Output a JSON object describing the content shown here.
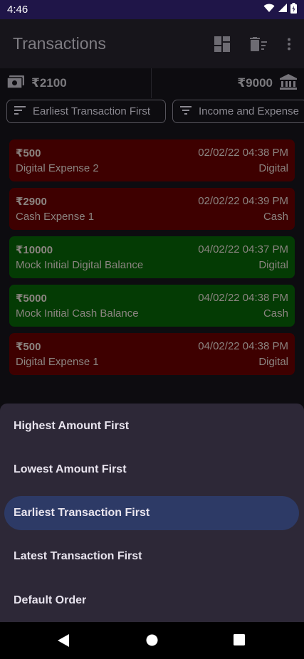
{
  "status_bar": {
    "time": "4:46"
  },
  "app_bar": {
    "title": "Transactions"
  },
  "balances": {
    "cash": "₹2100",
    "digital": "₹9000"
  },
  "filters": {
    "sort": "Earliest Transaction First",
    "type": "Income and Expense"
  },
  "transactions": [
    {
      "amount": "₹500",
      "datetime": "02/02/22 04:38 PM",
      "description": "Digital Expense 2",
      "mode": "Digital",
      "kind": "expense"
    },
    {
      "amount": "₹2900",
      "datetime": "02/02/22 04:39 PM",
      "description": "Cash Expense 1",
      "mode": "Cash",
      "kind": "expense"
    },
    {
      "amount": "₹10000",
      "datetime": "04/02/22 04:37 PM",
      "description": "Mock Initial Digital Balance",
      "mode": "Digital",
      "kind": "income"
    },
    {
      "amount": "₹5000",
      "datetime": "04/02/22 04:38 PM",
      "description": "Mock Initial Cash Balance",
      "mode": "Cash",
      "kind": "income"
    },
    {
      "amount": "₹500",
      "datetime": "04/02/22 04:38 PM",
      "description": "Digital Expense 1",
      "mode": "Digital",
      "kind": "expense"
    }
  ],
  "sort_sheet": {
    "options": [
      "Highest Amount First",
      "Lowest Amount First",
      "Earliest Transaction First",
      "Latest Transaction First",
      "Default Order"
    ],
    "selected": "Earliest Transaction First"
  },
  "colors": {
    "expense_card": "#3e0000",
    "income_card": "#043b04",
    "sheet_background": "#2d2837",
    "selected_option": "#2d3a66",
    "status_bar": "#1f1548"
  },
  "icons": {
    "status": [
      "wifi-icon",
      "signal-icon",
      "battery-icon"
    ],
    "app_bar": [
      "dashboard-icon",
      "delete-sweep-icon",
      "more-vert-icon"
    ],
    "balances": [
      "cash-icon",
      "bank-icon"
    ],
    "filters": [
      "sort-icon",
      "filter-icon"
    ],
    "nav": [
      "back-icon",
      "home-icon",
      "recents-icon"
    ]
  }
}
